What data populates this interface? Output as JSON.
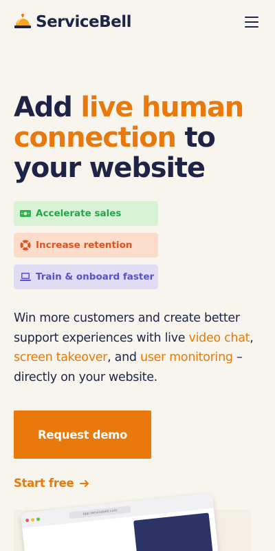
{
  "header": {
    "brand": "ServiceBell",
    "logo_icon": "service-bell-icon",
    "menu_icon": "hamburger-menu-icon"
  },
  "hero": {
    "title_part1": "Add ",
    "title_accent1": "live human connection",
    "title_part2": " to your website"
  },
  "features": [
    {
      "label": "Accelerate sales",
      "icon": "money-icon",
      "color": "#26a64a",
      "bg": "#d8f2d6"
    },
    {
      "label": "Increase retention",
      "icon": "lifebuoy-icon",
      "color": "#e2501c",
      "bg": "#fbdccb"
    },
    {
      "label": "Train & onboard faster",
      "icon": "laptop-icon",
      "color": "#5a4fd1",
      "bg": "#dfdcf4"
    }
  ],
  "description": {
    "text1": "Win more customers and create better support experiences with live ",
    "link1": "video chat",
    "text2": ", ",
    "link2": "screen takeover",
    "text3": ", and ",
    "link3": "user monitoring",
    "text4": " – directly on your website."
  },
  "cta": {
    "primary_label": "Request demo",
    "secondary_label": "Start free",
    "secondary_icon": "arrow-right-icon"
  },
  "preview": {
    "url": "app.servicebell.com"
  },
  "colors": {
    "accent": "#e8790a",
    "navy": "#1f2446",
    "background": "#f8f5ef"
  }
}
